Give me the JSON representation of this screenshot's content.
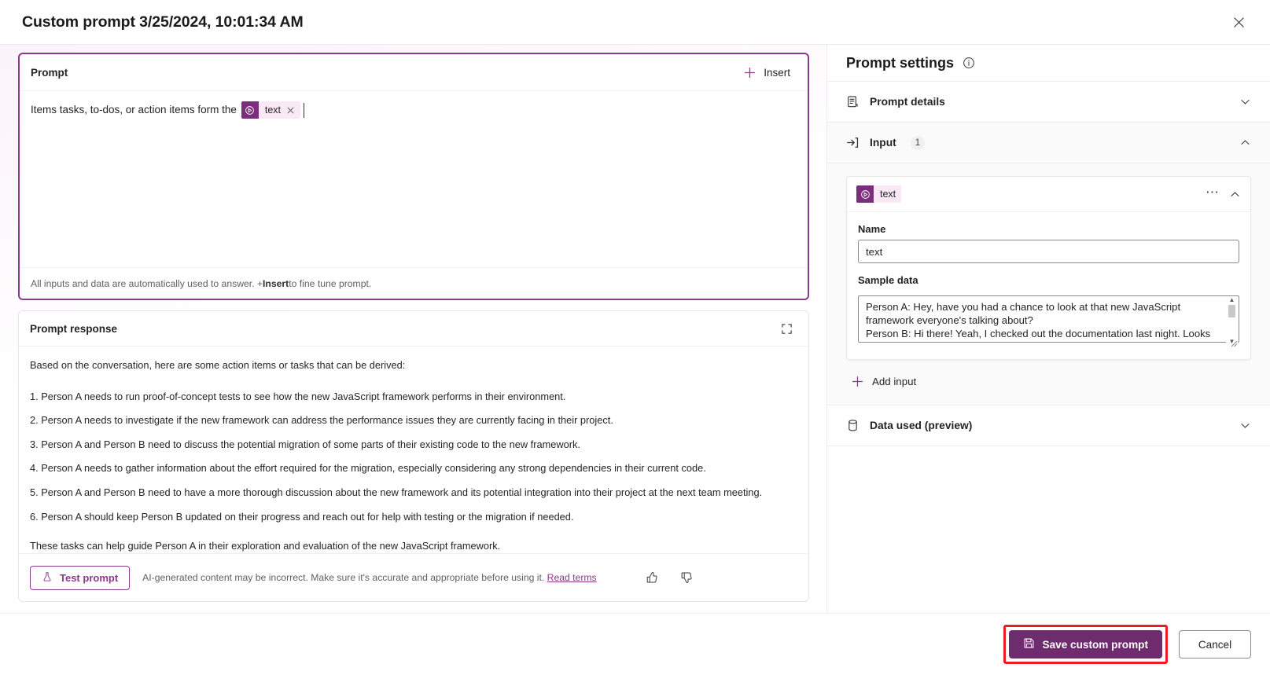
{
  "window": {
    "title": "Custom prompt 3/25/2024, 10:01:34 AM",
    "close_label": "✕"
  },
  "prompt_card": {
    "header_label": "Prompt",
    "insert_label": "Insert",
    "text_before_chip": "Items tasks, to-dos, or action items form the",
    "chip": {
      "label": "text",
      "remove_label": "✕"
    },
    "footer_prefix": "All inputs and data are automatically used to answer. + ",
    "footer_bold": "Insert",
    "footer_suffix": " to fine tune prompt."
  },
  "response_card": {
    "header_label": "Prompt response",
    "intro": "Based on the conversation, here are some action items or tasks that can be derived:",
    "items": [
      "1. Person A needs to run proof-of-concept tests to see how the new JavaScript framework performs in their environment.",
      "2. Person A needs to investigate if the new framework can address the performance issues they are currently facing in their project.",
      "3. Person A and Person B need to discuss the potential migration of some parts of their existing code to the new framework.",
      "4. Person A needs to gather information about the effort required for the migration, especially considering any strong dependencies in their current code.",
      "5. Person A and Person B need to have a more thorough discussion about the new framework and its potential integration into their project at the next team meeting.",
      "6. Person A should keep Person B updated on their progress and reach out for help with testing or the migration if needed."
    ],
    "outro": "These tasks can help guide Person A in their exploration and evaluation of the new JavaScript framework.",
    "test_button_label": "Test prompt",
    "disclaimer_text": "AI-generated content may be incorrect. Make sure it's accurate and appropriate before using it. ",
    "disclaimer_link": "Read terms"
  },
  "settings_panel": {
    "title": "Prompt settings",
    "sections": [
      {
        "label": "Prompt details",
        "expanded": false
      },
      {
        "label": "Input",
        "count": "1",
        "expanded": true
      },
      {
        "label": "Data used (preview)",
        "expanded": false
      }
    ],
    "input_card": {
      "chip_label": "text",
      "name_label": "Name",
      "name_value": "text",
      "sample_label": "Sample data",
      "sample_value": "Person A: Hey, have you had a chance to look at that new JavaScript framework everyone's talking about?\nPerson B: Hi there! Yeah, I checked out the documentation last night. Looks impressive. Before we commit, we'll likely need to"
    },
    "add_input_label": "Add input"
  },
  "footer": {
    "save_label": "Save custom prompt",
    "cancel_label": "Cancel"
  },
  "colors": {
    "accent_purple": "#6e2b6e",
    "chip_purple": "#7b2e7b",
    "chip_bg": "#fae8f7",
    "link_purple": "#8a3a8a",
    "highlight_red": "#ec1c24"
  }
}
